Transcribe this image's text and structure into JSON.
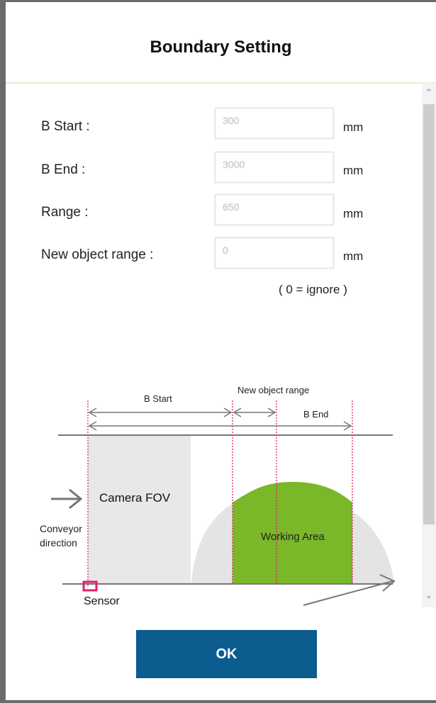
{
  "dialog": {
    "title": "Boundary Setting"
  },
  "fields": [
    {
      "label": "B Start :",
      "value": "300",
      "unit": "mm"
    },
    {
      "label": "B End :",
      "value": "3000",
      "unit": "mm"
    },
    {
      "label": "Range :",
      "value": "650",
      "unit": "mm"
    },
    {
      "label": "New object range :",
      "value": "0",
      "unit": "mm"
    }
  ],
  "hint": "( 0 = ignore )",
  "diagram": {
    "b_start_label": "B Start",
    "new_object_range_label": "New object range",
    "b_end_label": "B End",
    "camera_fov_label": "Camera FOV",
    "conveyor_label_line1": "Conveyor",
    "conveyor_label_line2": "direction",
    "working_area_label": "Working Area",
    "sensor_label": "Sensor",
    "colors": {
      "working_area": "#7ab829",
      "fov": "#e8e8e8",
      "guide_line": "#e0206b",
      "sensor": "#e0206b"
    }
  },
  "footer": {
    "ok_label": "OK"
  },
  "colors": {
    "primary_button": "#0b5c8f"
  }
}
